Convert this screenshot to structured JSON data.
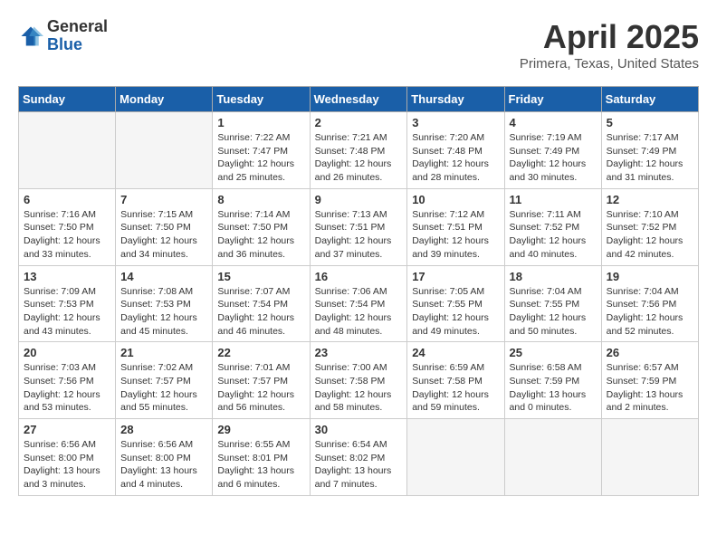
{
  "header": {
    "logo_general": "General",
    "logo_blue": "Blue",
    "title": "April 2025",
    "subtitle": "Primera, Texas, United States"
  },
  "weekdays": [
    "Sunday",
    "Monday",
    "Tuesday",
    "Wednesday",
    "Thursday",
    "Friday",
    "Saturday"
  ],
  "weeks": [
    [
      {
        "day": "",
        "info": ""
      },
      {
        "day": "",
        "info": ""
      },
      {
        "day": "1",
        "info": "Sunrise: 7:22 AM\nSunset: 7:47 PM\nDaylight: 12 hours and 25 minutes."
      },
      {
        "day": "2",
        "info": "Sunrise: 7:21 AM\nSunset: 7:48 PM\nDaylight: 12 hours and 26 minutes."
      },
      {
        "day": "3",
        "info": "Sunrise: 7:20 AM\nSunset: 7:48 PM\nDaylight: 12 hours and 28 minutes."
      },
      {
        "day": "4",
        "info": "Sunrise: 7:19 AM\nSunset: 7:49 PM\nDaylight: 12 hours and 30 minutes."
      },
      {
        "day": "5",
        "info": "Sunrise: 7:17 AM\nSunset: 7:49 PM\nDaylight: 12 hours and 31 minutes."
      }
    ],
    [
      {
        "day": "6",
        "info": "Sunrise: 7:16 AM\nSunset: 7:50 PM\nDaylight: 12 hours and 33 minutes."
      },
      {
        "day": "7",
        "info": "Sunrise: 7:15 AM\nSunset: 7:50 PM\nDaylight: 12 hours and 34 minutes."
      },
      {
        "day": "8",
        "info": "Sunrise: 7:14 AM\nSunset: 7:50 PM\nDaylight: 12 hours and 36 minutes."
      },
      {
        "day": "9",
        "info": "Sunrise: 7:13 AM\nSunset: 7:51 PM\nDaylight: 12 hours and 37 minutes."
      },
      {
        "day": "10",
        "info": "Sunrise: 7:12 AM\nSunset: 7:51 PM\nDaylight: 12 hours and 39 minutes."
      },
      {
        "day": "11",
        "info": "Sunrise: 7:11 AM\nSunset: 7:52 PM\nDaylight: 12 hours and 40 minutes."
      },
      {
        "day": "12",
        "info": "Sunrise: 7:10 AM\nSunset: 7:52 PM\nDaylight: 12 hours and 42 minutes."
      }
    ],
    [
      {
        "day": "13",
        "info": "Sunrise: 7:09 AM\nSunset: 7:53 PM\nDaylight: 12 hours and 43 minutes."
      },
      {
        "day": "14",
        "info": "Sunrise: 7:08 AM\nSunset: 7:53 PM\nDaylight: 12 hours and 45 minutes."
      },
      {
        "day": "15",
        "info": "Sunrise: 7:07 AM\nSunset: 7:54 PM\nDaylight: 12 hours and 46 minutes."
      },
      {
        "day": "16",
        "info": "Sunrise: 7:06 AM\nSunset: 7:54 PM\nDaylight: 12 hours and 48 minutes."
      },
      {
        "day": "17",
        "info": "Sunrise: 7:05 AM\nSunset: 7:55 PM\nDaylight: 12 hours and 49 minutes."
      },
      {
        "day": "18",
        "info": "Sunrise: 7:04 AM\nSunset: 7:55 PM\nDaylight: 12 hours and 50 minutes."
      },
      {
        "day": "19",
        "info": "Sunrise: 7:04 AM\nSunset: 7:56 PM\nDaylight: 12 hours and 52 minutes."
      }
    ],
    [
      {
        "day": "20",
        "info": "Sunrise: 7:03 AM\nSunset: 7:56 PM\nDaylight: 12 hours and 53 minutes."
      },
      {
        "day": "21",
        "info": "Sunrise: 7:02 AM\nSunset: 7:57 PM\nDaylight: 12 hours and 55 minutes."
      },
      {
        "day": "22",
        "info": "Sunrise: 7:01 AM\nSunset: 7:57 PM\nDaylight: 12 hours and 56 minutes."
      },
      {
        "day": "23",
        "info": "Sunrise: 7:00 AM\nSunset: 7:58 PM\nDaylight: 12 hours and 58 minutes."
      },
      {
        "day": "24",
        "info": "Sunrise: 6:59 AM\nSunset: 7:58 PM\nDaylight: 12 hours and 59 minutes."
      },
      {
        "day": "25",
        "info": "Sunrise: 6:58 AM\nSunset: 7:59 PM\nDaylight: 13 hours and 0 minutes."
      },
      {
        "day": "26",
        "info": "Sunrise: 6:57 AM\nSunset: 7:59 PM\nDaylight: 13 hours and 2 minutes."
      }
    ],
    [
      {
        "day": "27",
        "info": "Sunrise: 6:56 AM\nSunset: 8:00 PM\nDaylight: 13 hours and 3 minutes."
      },
      {
        "day": "28",
        "info": "Sunrise: 6:56 AM\nSunset: 8:00 PM\nDaylight: 13 hours and 4 minutes."
      },
      {
        "day": "29",
        "info": "Sunrise: 6:55 AM\nSunset: 8:01 PM\nDaylight: 13 hours and 6 minutes."
      },
      {
        "day": "30",
        "info": "Sunrise: 6:54 AM\nSunset: 8:02 PM\nDaylight: 13 hours and 7 minutes."
      },
      {
        "day": "",
        "info": ""
      },
      {
        "day": "",
        "info": ""
      },
      {
        "day": "",
        "info": ""
      }
    ]
  ]
}
